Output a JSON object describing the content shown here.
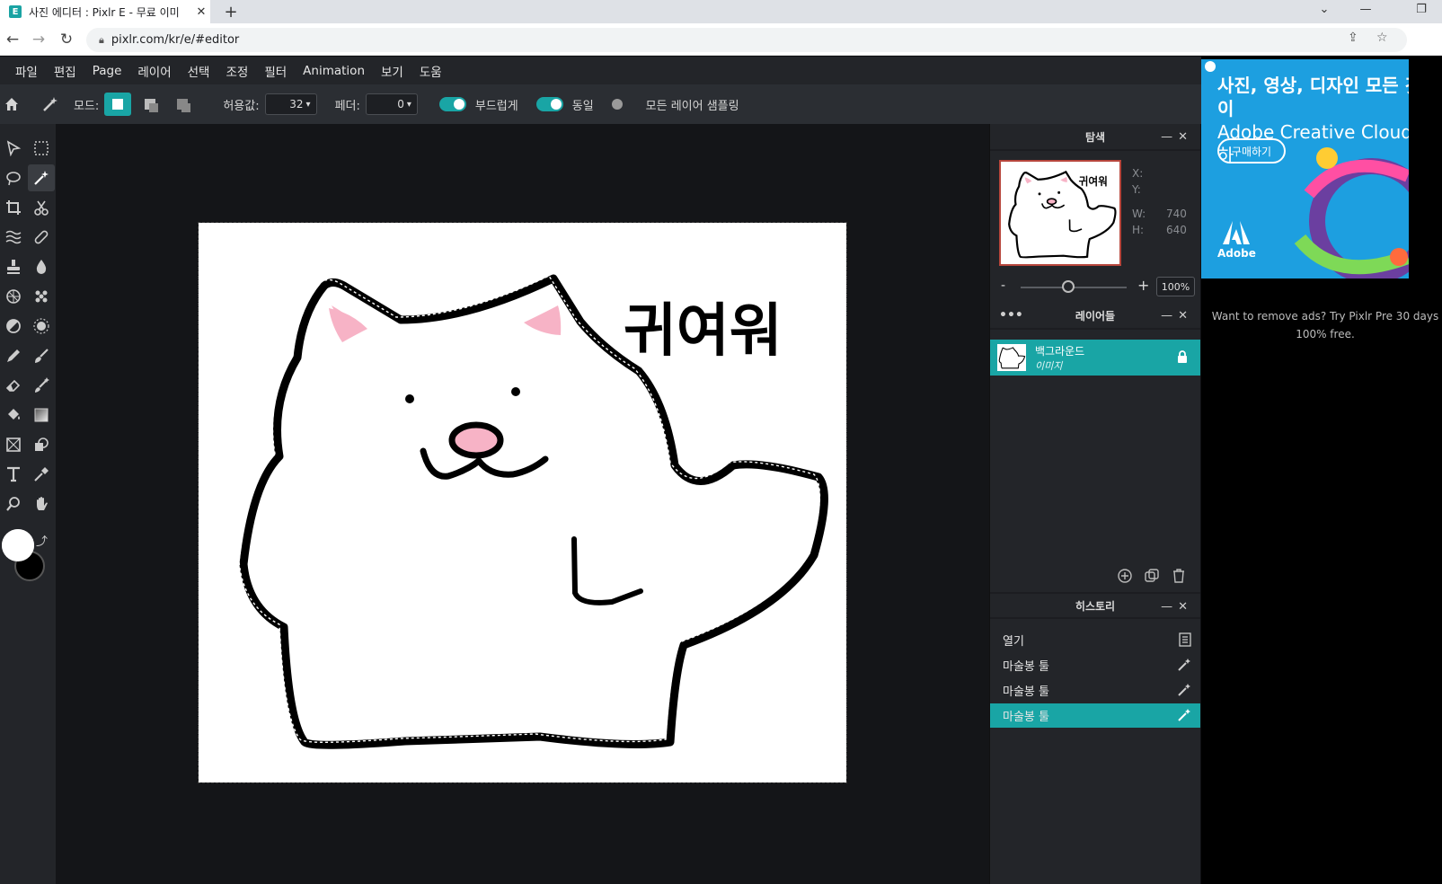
{
  "browser": {
    "tab_title": "사진 에디터 : Pixlr E - 무료 이미",
    "favicon": "E",
    "tab_close": "✕",
    "new_tab": "+",
    "url": "pixlr.com/kr/e/#editor",
    "window_controls": [
      "⌄",
      "—",
      "❐"
    ]
  },
  "menu": [
    "파일",
    "편집",
    "Page",
    "레이어",
    "선택",
    "조정",
    "필터",
    "Animation",
    "보기",
    "도움"
  ],
  "toolbar": {
    "mode_label": "모드:",
    "tolerance_label": "허용값:",
    "tolerance_value": "32",
    "feather_label": "페더:",
    "feather_value": "0",
    "smooth_label": "부드럽게",
    "contiguous_label": "동일",
    "sample_all_label": "모든 레이어 샘플링"
  },
  "canvas": {
    "text": "귀여워"
  },
  "navigator": {
    "title": "탐색",
    "x_label": "X:",
    "y_label": "Y:",
    "w_label": "W:",
    "w_value": "740",
    "h_label": "H:",
    "h_value": "640",
    "zoom_minus": "-",
    "zoom_plus": "+",
    "zoom_value": "100%",
    "zoom_level": 0.45
  },
  "layers": {
    "title": "레이어들",
    "items": [
      {
        "name": "백그라운드",
        "type": "이미지"
      }
    ]
  },
  "history": {
    "title": "히스토리",
    "items": [
      {
        "label": "열기",
        "icon": "document-icon"
      },
      {
        "label": "마술봉 툴",
        "icon": "magic-wand-icon"
      },
      {
        "label": "마술봉 툴",
        "icon": "magic-wand-icon"
      },
      {
        "label": "마술봉 툴",
        "icon": "magic-wand-icon"
      }
    ]
  },
  "ad": {
    "headline_1": "사진, 영상, 디자인 모든 것이",
    "headline_2": "Adobe Creative Cloud 하",
    "button": "구매하기",
    "brand": "Adobe",
    "note": "Want to remove ads? Try Pixlr Pre 30 days 100% free."
  },
  "colors": {
    "accent": "#19a5a5",
    "panel": "#232529",
    "workspace": "#141518",
    "ad_blue": "#1d9fe0"
  }
}
